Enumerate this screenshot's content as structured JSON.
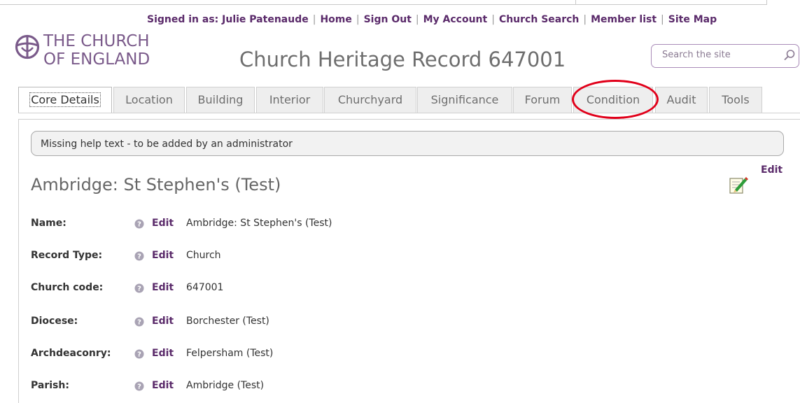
{
  "utility_nav": {
    "signed_in": "Signed in as: Julie Patenaude",
    "links": [
      "Home",
      "Sign Out",
      "My Account",
      "Church Search",
      "Member list",
      "Site Map"
    ]
  },
  "logo": {
    "line1": "THE CHURCH",
    "line2": "OF ENGLAND"
  },
  "page_title": "Church Heritage Record 647001",
  "search": {
    "placeholder": "Search the site"
  },
  "tabs": [
    "Core Details",
    "Location",
    "Building",
    "Interior",
    "Churchyard",
    "Significance",
    "Forum",
    "Condition",
    "Audit",
    "Tools"
  ],
  "active_tab": "Core Details",
  "help_text": "Missing help text - to be added by an administrator",
  "record": {
    "heading": "Ambridge: St Stephen's (Test)",
    "edit_label": "Edit",
    "fields": [
      {
        "label": "Name:",
        "edit": "Edit",
        "value": "Ambridge: St Stephen's (Test)"
      },
      {
        "label": "Record Type:",
        "edit": "Edit",
        "value": "Church"
      },
      {
        "label": "Church code:",
        "edit": "Edit",
        "value": "647001"
      },
      {
        "label": "Diocese:",
        "edit": "Edit",
        "value": "Borchester (Test)"
      },
      {
        "label": "Archdeaconry:",
        "edit": "Edit",
        "value": "Felpersham (Test)"
      },
      {
        "label": "Parish:",
        "edit": "Edit",
        "value": "Ambridge (Test)"
      }
    ]
  },
  "icons": {
    "logo": "church-cross-icon",
    "search": "search-icon",
    "edit": "edit-pencil-icon",
    "help": "help-question-icon"
  },
  "colors": {
    "brand_purple": "#5a2a6a",
    "logo_purple": "#7a5a8a",
    "callout_red": "#e1001a"
  }
}
